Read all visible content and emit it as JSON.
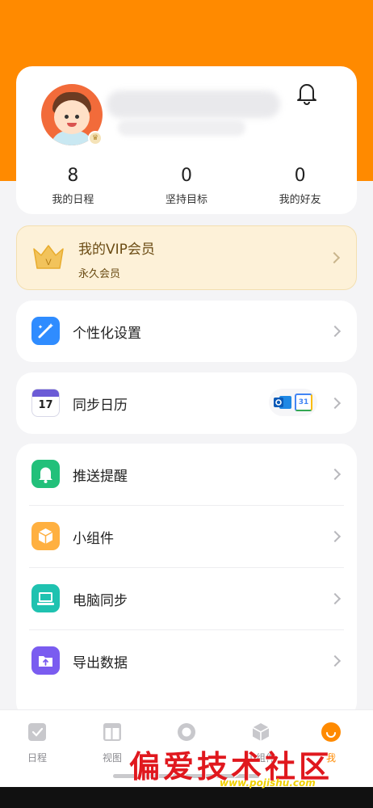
{
  "profile": {
    "stats": [
      {
        "value": "8",
        "label": "我的日程"
      },
      {
        "value": "0",
        "label": "坚持目标"
      },
      {
        "value": "0",
        "label": "我的好友"
      }
    ]
  },
  "vip": {
    "title": "我的VIP会员",
    "subtitle": "永久会员"
  },
  "menu": {
    "personalize": "个性化设置",
    "sync_calendar": "同步日历",
    "sync_calendar_day": "17",
    "google_cal_day": "31",
    "push_reminder": "推送提醒",
    "widget": "小组件",
    "pc_sync": "电脑同步",
    "export_data": "导出数据"
  },
  "bottom_nav": [
    {
      "label": "日程",
      "icon": "check-square-icon"
    },
    {
      "label": "视图",
      "icon": "layout-icon"
    },
    {
      "label": "",
      "icon": "circle-icon"
    },
    {
      "label": "小组件",
      "icon": "cube-icon"
    },
    {
      "label": "我",
      "icon": "profile-icon"
    }
  ],
  "watermark": {
    "text": "偏爱技术社区",
    "url": "www.pojishu.com"
  },
  "colors": {
    "accent": "#ff8a00",
    "vip_bg": "#fdf1d8",
    "background": "#f4f4f6"
  }
}
